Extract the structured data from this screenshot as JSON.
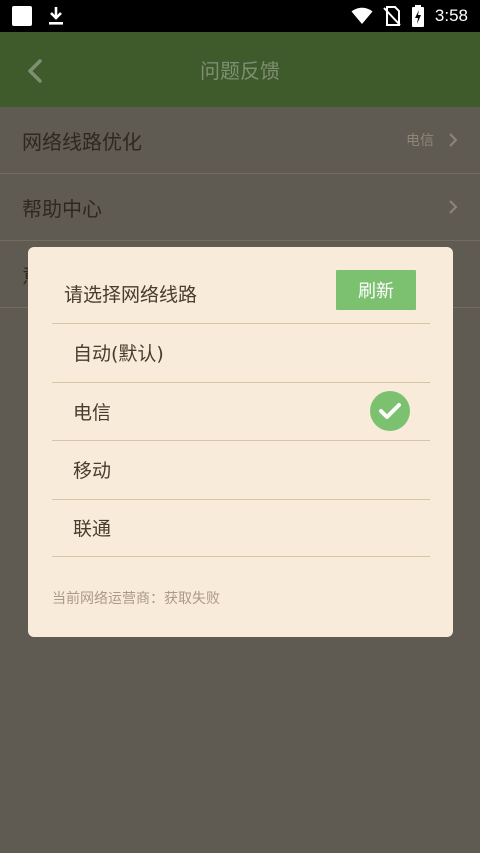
{
  "status_bar": {
    "time": "3:58",
    "icons": [
      "notification-square-icon",
      "download-icon",
      "wifi-icon",
      "no-sim-icon",
      "battery-charging-icon"
    ]
  },
  "app_bar": {
    "title": "问题反馈",
    "back_icon": "chevron-left-icon"
  },
  "settings": {
    "rows": [
      {
        "label": "网络线路优化",
        "value": "电信"
      },
      {
        "label": "帮助中心"
      },
      {
        "label": "意"
      }
    ]
  },
  "dialog": {
    "title": "请选择网络线路",
    "refresh_label": "刷新",
    "options": [
      {
        "label": "自动(默认)",
        "selected": false
      },
      {
        "label": "电信",
        "selected": true
      },
      {
        "label": "移动",
        "selected": false
      },
      {
        "label": "联通",
        "selected": false
      }
    ],
    "footer": "当前网络运营商：获取失败"
  },
  "colors": {
    "app_bar": "#3f5b2c",
    "dim_overlay": "#5f5a52",
    "dialog_bg": "#f9ebd9",
    "accent_green": "#7cc16f"
  }
}
